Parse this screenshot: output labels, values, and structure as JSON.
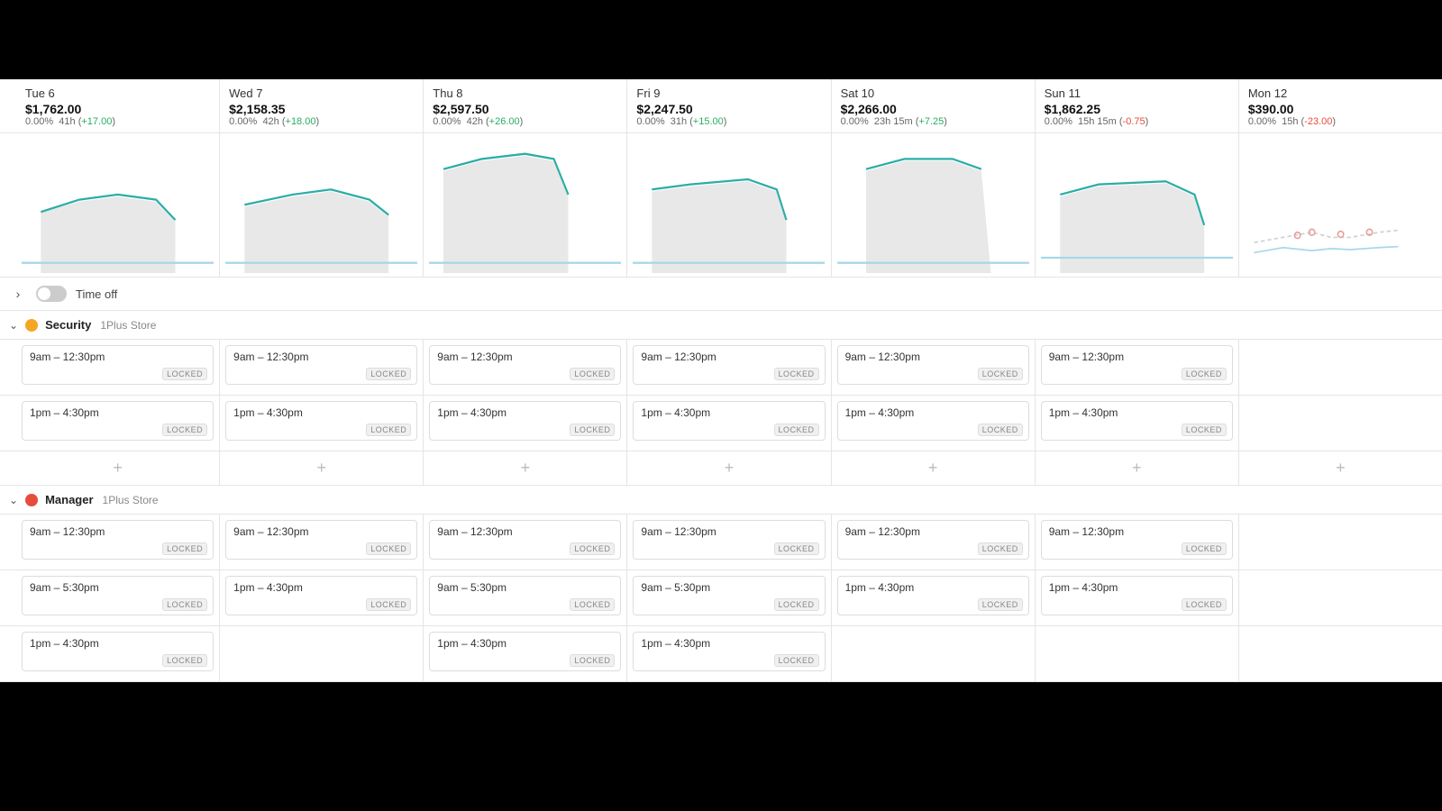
{
  "topBar": {
    "height": 88
  },
  "days": [
    {
      "id": "tue6",
      "name": "Tue 6",
      "total": "$1,762.00",
      "percent": "0.00%",
      "hours": "41h",
      "delta": "+17.00",
      "deltaPositive": true
    },
    {
      "id": "wed7",
      "name": "Wed 7",
      "total": "$2,158.35",
      "percent": "0.00%",
      "hours": "42h",
      "delta": "+18.00",
      "deltaPositive": true
    },
    {
      "id": "thu8",
      "name": "Thu 8",
      "total": "$2,597.50",
      "percent": "0.00%",
      "hours": "42h",
      "delta": "+26.00",
      "deltaPositive": true
    },
    {
      "id": "fri9",
      "name": "Fri 9",
      "total": "$2,247.50",
      "percent": "0.00%",
      "hours": "31h",
      "delta": "+15.00",
      "deltaPositive": true
    },
    {
      "id": "sat10",
      "name": "Sat 10",
      "total": "$2,266.00",
      "percent": "0.00%",
      "hours": "23h 15m",
      "delta": "+7.25",
      "deltaPositive": true
    },
    {
      "id": "sun11",
      "name": "Sun 11",
      "total": "$1,862.25",
      "percent": "0.00%",
      "hours": "15h 15m",
      "delta": "-0.75",
      "deltaPositive": false
    },
    {
      "id": "mon12",
      "name": "Mon 12",
      "total": "$390.00",
      "percent": "0.00%",
      "hours": "15h",
      "delta": "-23.00",
      "deltaPositive": false
    }
  ],
  "controls": {
    "timeOffLabel": "Time off",
    "toggleOn": false
  },
  "sections": [
    {
      "id": "security",
      "roleName": "Security",
      "storeName": "1Plus Store",
      "roleColor": "security",
      "rows": [
        {
          "shifts": [
            {
              "time": "9am – 12:30pm",
              "locked": true
            },
            {
              "time": "9am – 12:30pm",
              "locked": true
            },
            {
              "time": "9am – 12:30pm",
              "locked": true
            },
            {
              "time": "9am – 12:30pm",
              "locked": true
            },
            {
              "time": "9am – 12:30pm",
              "locked": true
            },
            {
              "time": "9am – 12:30pm",
              "locked": true
            },
            {
              "time": "",
              "locked": false
            }
          ]
        },
        {
          "shifts": [
            {
              "time": "1pm – 4:30pm",
              "locked": true
            },
            {
              "time": "1pm – 4:30pm",
              "locked": true
            },
            {
              "time": "1pm – 4:30pm",
              "locked": true
            },
            {
              "time": "1pm – 4:30pm",
              "locked": true
            },
            {
              "time": "1pm – 4:30pm",
              "locked": true
            },
            {
              "time": "1pm – 4:30pm",
              "locked": true
            },
            {
              "time": "",
              "locked": false
            }
          ]
        }
      ],
      "addRow": true
    },
    {
      "id": "manager",
      "roleName": "Manager",
      "storeName": "1Plus Store",
      "roleColor": "manager",
      "rows": [
        {
          "shifts": [
            {
              "time": "9am – 12:30pm",
              "locked": true
            },
            {
              "time": "9am – 12:30pm",
              "locked": true
            },
            {
              "time": "9am – 12:30pm",
              "locked": true
            },
            {
              "time": "9am – 12:30pm",
              "locked": true
            },
            {
              "time": "9am – 12:30pm",
              "locked": true
            },
            {
              "time": "9am – 12:30pm",
              "locked": true
            },
            {
              "time": "",
              "locked": false
            }
          ]
        },
        {
          "shifts": [
            {
              "time": "9am – 5:30pm",
              "locked": true
            },
            {
              "time": "1pm – 4:30pm",
              "locked": true
            },
            {
              "time": "9am – 5:30pm",
              "locked": true
            },
            {
              "time": "9am – 5:30pm",
              "locked": true
            },
            {
              "time": "1pm – 4:30pm",
              "locked": true
            },
            {
              "time": "1pm – 4:30pm",
              "locked": true
            },
            {
              "time": "",
              "locked": false
            }
          ]
        },
        {
          "shifts": [
            {
              "time": "1pm – 4:30pm",
              "locked": true
            },
            {
              "time": "",
              "locked": false
            },
            {
              "time": "1pm – 4:30pm",
              "locked": true
            },
            {
              "time": "1pm – 4:30pm",
              "locked": true
            },
            {
              "time": "",
              "locked": false
            },
            {
              "time": "",
              "locked": false
            },
            {
              "time": "",
              "locked": false
            }
          ]
        }
      ],
      "addRow": false
    }
  ],
  "labels": {
    "locked": "LOCKED",
    "addShift": "+",
    "expandIcon": "›",
    "collapseIcon": "‹"
  }
}
